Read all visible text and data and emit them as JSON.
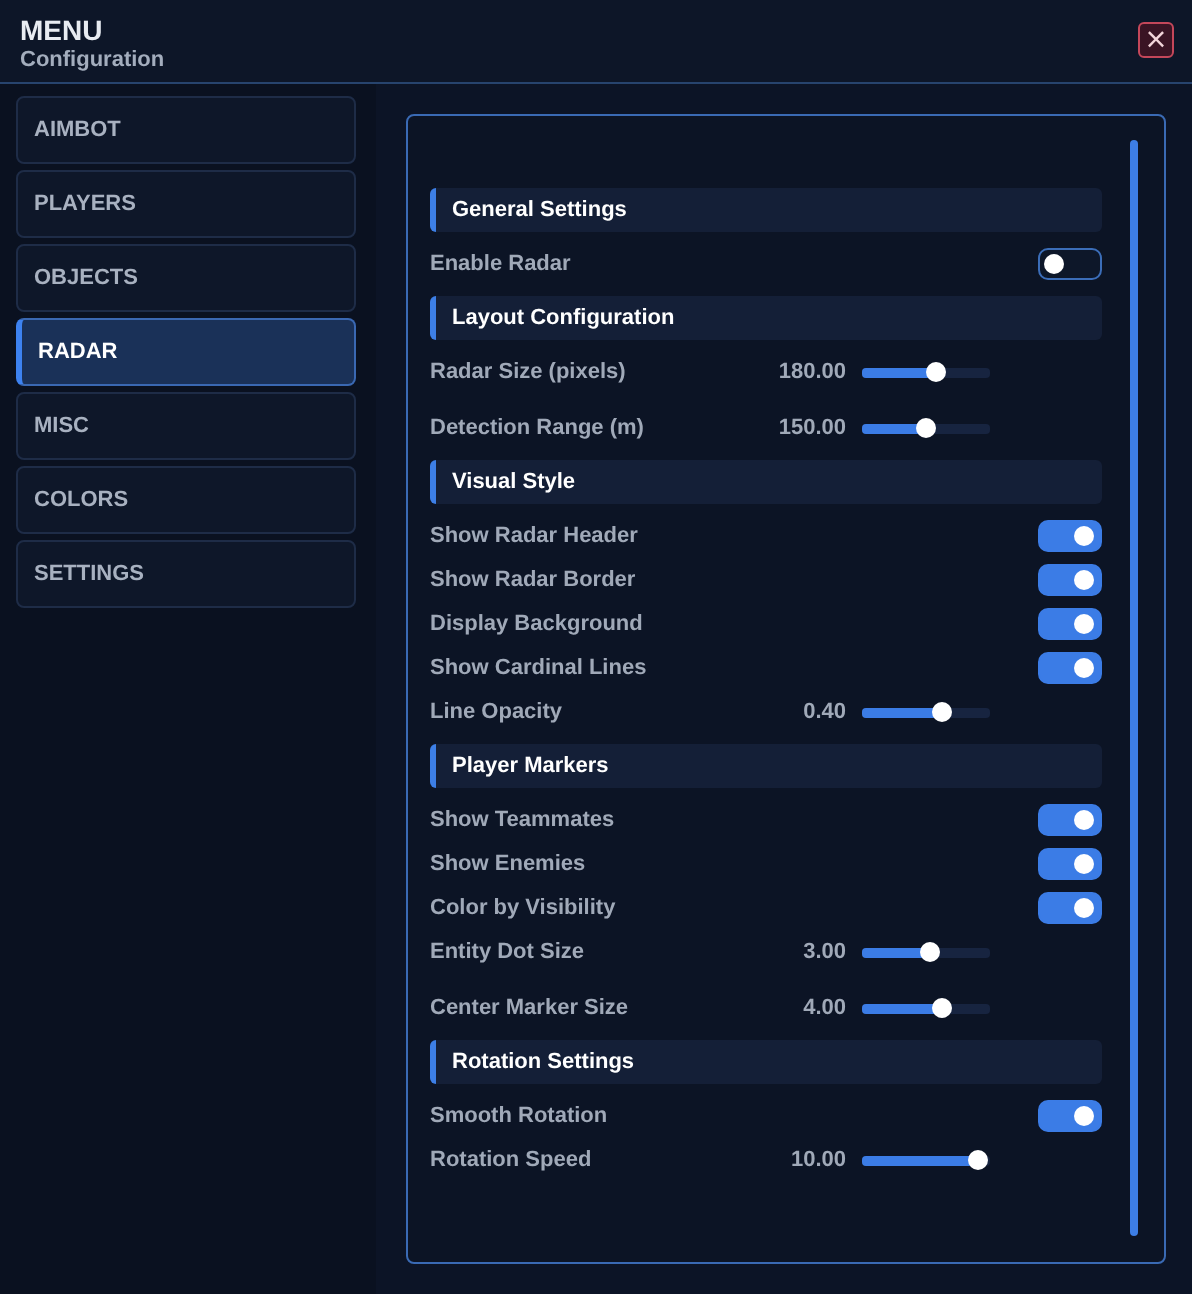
{
  "window": {
    "title": "MENU",
    "subtitle": "Configuration",
    "close": "×"
  },
  "sidebar": {
    "items": [
      {
        "label": "AIMBOT",
        "selected": false
      },
      {
        "label": "PLAYERS",
        "selected": false
      },
      {
        "label": "OBJECTS",
        "selected": false
      },
      {
        "label": "RADAR",
        "selected": true
      },
      {
        "label": "MISC",
        "selected": false
      },
      {
        "label": "COLORS",
        "selected": false
      },
      {
        "label": "SETTINGS",
        "selected": false
      }
    ]
  },
  "sections": [
    {
      "title": "General Settings",
      "rows": [
        {
          "kind": "toggle",
          "label": "Enable Radar",
          "on": false
        }
      ]
    },
    {
      "title": "Layout Configuration",
      "rows": [
        {
          "kind": "slider",
          "label": "Radar Size (pixels)",
          "reading": "180.00",
          "level": 0.58
        },
        {
          "kind": "slider",
          "label": "Detection Range (m)",
          "reading": "150.00",
          "level": 0.5
        }
      ]
    },
    {
      "title": "Visual Style",
      "rows": [
        {
          "kind": "toggle",
          "label": "Show Radar Header",
          "on": true
        },
        {
          "kind": "toggle",
          "label": "Show Radar Border",
          "on": true
        },
        {
          "kind": "toggle",
          "label": "Display Background",
          "on": true
        },
        {
          "kind": "toggle",
          "label": "Show Cardinal Lines",
          "on": true
        },
        {
          "kind": "slider",
          "label": "Line Opacity",
          "reading": "0.40",
          "level": 0.63
        }
      ]
    },
    {
      "title": "Player Markers",
      "rows": [
        {
          "kind": "toggle",
          "label": "Show Teammates",
          "on": true
        },
        {
          "kind": "toggle",
          "label": "Show Enemies",
          "on": true
        },
        {
          "kind": "toggle",
          "label": "Color by Visibility",
          "on": true
        },
        {
          "kind": "slider",
          "label": "Entity Dot Size",
          "reading": "3.00",
          "level": 0.53
        },
        {
          "kind": "slider",
          "label": "Center Marker Size",
          "reading": "4.00",
          "level": 0.63
        }
      ]
    },
    {
      "title": "Rotation Settings",
      "rows": [
        {
          "kind": "toggle",
          "label": "Smooth Rotation",
          "on": true
        },
        {
          "kind": "slider",
          "label": "Rotation Speed",
          "reading": "10.00",
          "level": 0.9
        }
      ]
    }
  ]
}
